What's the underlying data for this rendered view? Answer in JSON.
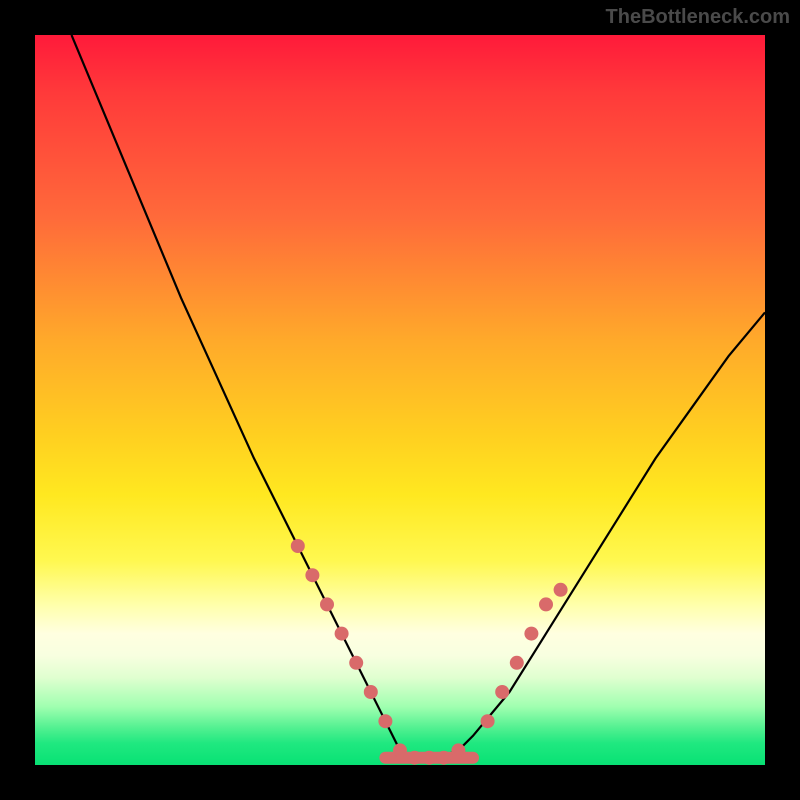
{
  "watermark": "TheBottleneck.com",
  "chart_data": {
    "type": "line",
    "title": "",
    "xlabel": "",
    "ylabel": "",
    "xlim": [
      0,
      100
    ],
    "ylim": [
      0,
      100
    ],
    "series": [
      {
        "name": "bottleneck-curve",
        "x": [
          5,
          10,
          15,
          20,
          25,
          30,
          35,
          40,
          42,
          45,
          48,
          50,
          52,
          55,
          58,
          60,
          65,
          70,
          75,
          80,
          85,
          90,
          95,
          100
        ],
        "values": [
          100,
          88,
          76,
          64,
          53,
          42,
          32,
          22,
          18,
          12,
          6,
          2,
          1,
          1,
          2,
          4,
          10,
          18,
          26,
          34,
          42,
          49,
          56,
          62
        ]
      }
    ],
    "markers": {
      "name": "highlight-dots",
      "x": [
        36,
        38,
        40,
        42,
        44,
        46,
        48,
        50,
        52,
        54,
        56,
        58,
        62,
        64,
        66,
        68,
        70,
        72
      ],
      "values": [
        30,
        26,
        22,
        18,
        14,
        10,
        6,
        2,
        1,
        1,
        1,
        2,
        6,
        10,
        14,
        18,
        22,
        24
      ]
    },
    "gradient_stops": [
      {
        "pct": 0,
        "color": "#ff1a3a"
      },
      {
        "pct": 25,
        "color": "#ff6a3a"
      },
      {
        "pct": 55,
        "color": "#ffd020"
      },
      {
        "pct": 78,
        "color": "#ffffaa"
      },
      {
        "pct": 92,
        "color": "#a0ffb0"
      },
      {
        "pct": 100,
        "color": "#08e074"
      }
    ]
  }
}
